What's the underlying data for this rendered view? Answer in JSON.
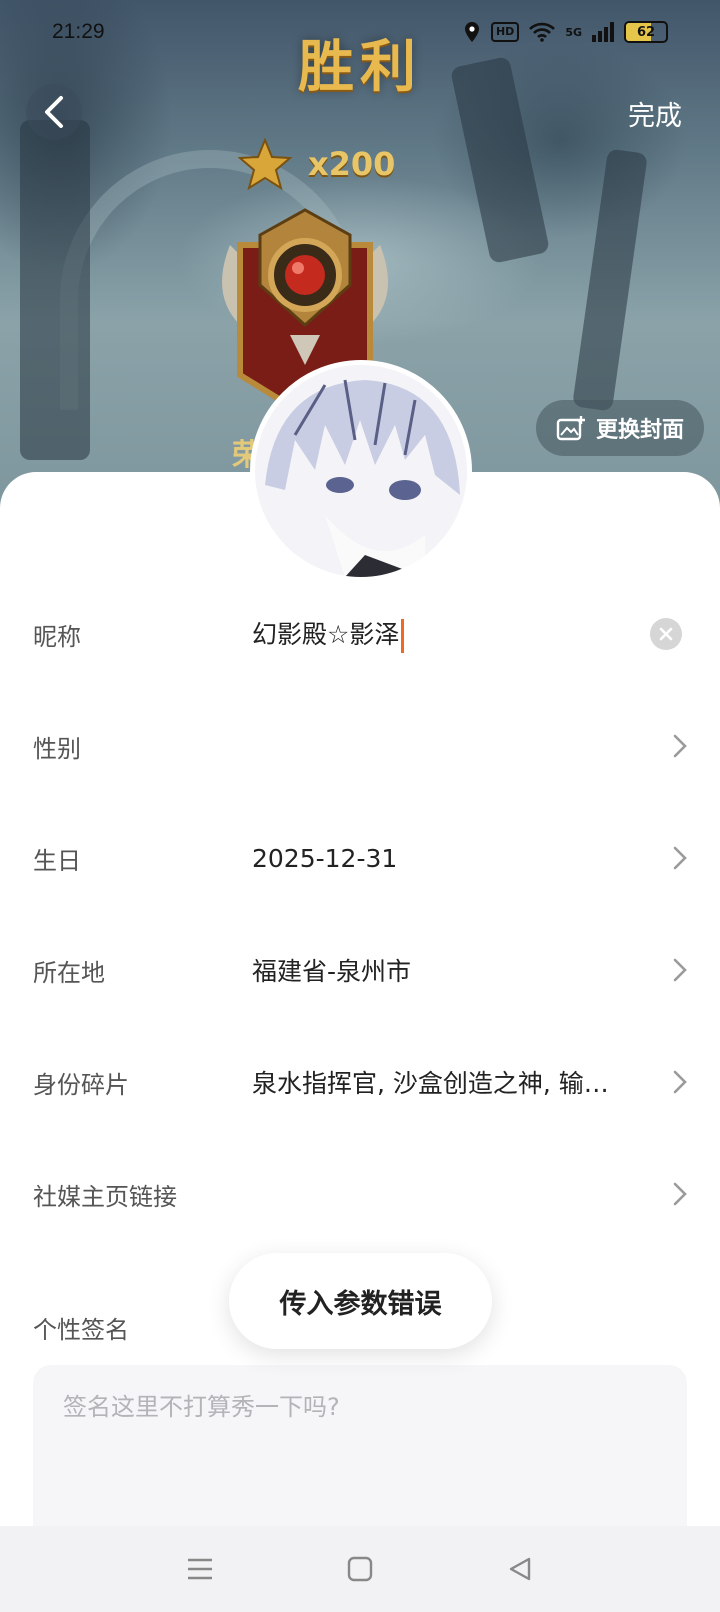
{
  "status_bar": {
    "time": "21:29",
    "hd": "HD",
    "network": "5G",
    "battery_level": 62,
    "battery_text": "62",
    "battery_color": "#e6c64a"
  },
  "header": {
    "victory_title": "胜利",
    "done_label": "完成",
    "star_count": "x200",
    "rank_partial_text": "荣",
    "change_cover_label": "更换封面"
  },
  "form": {
    "nickname": {
      "label": "昵称",
      "value": "幻影殿☆影泽"
    },
    "gender": {
      "label": "性别",
      "value": ""
    },
    "birthday": {
      "label": "生日",
      "value": "2025-12-31"
    },
    "location": {
      "label": "所在地",
      "value": "福建省-泉州市"
    },
    "identity": {
      "label": "身份碎片",
      "value": "泉水指挥官, 沙盒创造之神, 输…"
    },
    "social_link": {
      "label": "社媒主页链接",
      "value": ""
    },
    "signature": {
      "label": "个性签名",
      "placeholder": "签名这里不打算秀一下吗?"
    }
  },
  "toast": {
    "message": "传入参数错误"
  },
  "colors": {
    "accent_caret": "#ee6a1e",
    "gold": "#e8b94f"
  },
  "icons": [
    "back-arrow-icon",
    "star-icon",
    "rank-badge-icon",
    "image-add-icon",
    "clear-icon",
    "chevron-right-icon",
    "menu-icon",
    "home-square-icon",
    "back-triangle-icon",
    "location-icon",
    "wifi-icon",
    "signal-icon"
  ]
}
